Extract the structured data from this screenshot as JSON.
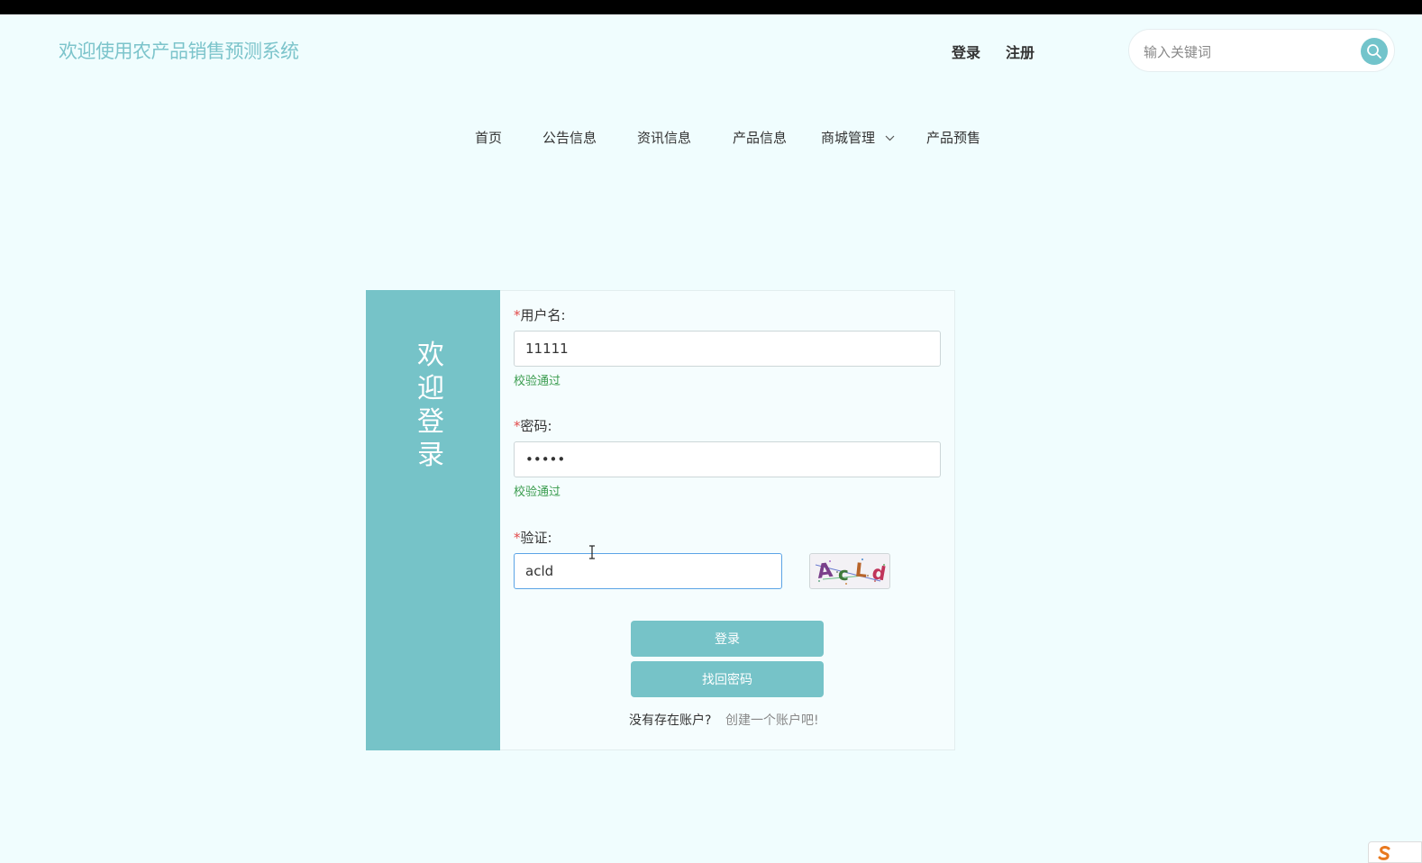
{
  "header": {
    "title": "欢迎使用农产品销售预测系统",
    "login_label": "登录",
    "register_label": "注册",
    "search": {
      "placeholder": "输入关键词",
      "value": ""
    }
  },
  "nav": {
    "items": [
      {
        "label": "首页"
      },
      {
        "label": "公告信息"
      },
      {
        "label": "资讯信息"
      },
      {
        "label": "产品信息"
      },
      {
        "label": "商城管理"
      },
      {
        "label": "产品预售"
      }
    ]
  },
  "login": {
    "side_title": "欢迎登录",
    "required_mark": "*",
    "username_label": "用户名:",
    "username_value": "11111",
    "username_hint": "校验通过",
    "password_label": "密码:",
    "password_value": "11111",
    "password_hint": "校验通过",
    "captcha_label": "验证:",
    "captcha_value": "acld",
    "captcha_text": "AcLd",
    "login_button": "登录",
    "recover_button": "找回密码",
    "no_account_text": "没有存在账户?",
    "create_account_link": "创建一个账户吧!"
  },
  "colors": {
    "accent": "#76c3c8",
    "title_color": "#7cc4cb",
    "page_bg": "#f0fdfe",
    "success_hint": "#3a9c4e",
    "required": "#e24a4a"
  },
  "icons": {
    "search": "search-icon",
    "dropdown": "chevron-down-icon"
  }
}
